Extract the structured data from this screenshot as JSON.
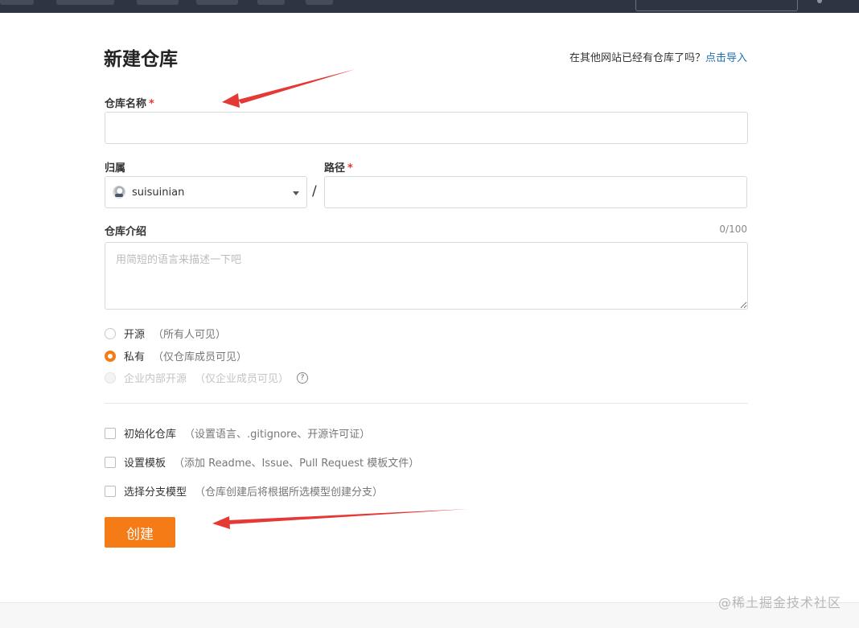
{
  "page": {
    "title": "新建仓库",
    "import_hint": "在其他网站已经有仓库了吗？",
    "import_link": "点击导入"
  },
  "form": {
    "repo_name": {
      "label": "仓库名称",
      "required_mark": "*",
      "value": ""
    },
    "owner": {
      "label": "归属",
      "value": "suisuinian"
    },
    "separator": "/",
    "path": {
      "label": "路径",
      "required_mark": "*",
      "value": ""
    },
    "description": {
      "label": "仓库介绍",
      "counter": "0/100",
      "placeholder": "用简短的语言来描述一下吧",
      "value": ""
    },
    "visibility": [
      {
        "label": "开源",
        "note": "（所有人可见）",
        "checked": false,
        "disabled": false
      },
      {
        "label": "私有",
        "note": "（仅仓库成员可见）",
        "checked": true,
        "disabled": false
      },
      {
        "label": "企业内部开源",
        "note": "（仅企业成员可见）",
        "checked": false,
        "disabled": true,
        "help_icon": "question-circle-icon"
      }
    ],
    "options": [
      {
        "label": "初始化仓库",
        "note": "（设置语言、.gitignore、开源许可证）",
        "checked": false
      },
      {
        "label": "设置模板",
        "note": "（添加 Readme、Issue、Pull Request 模板文件）",
        "checked": false
      },
      {
        "label": "选择分支模型",
        "note": "（仓库创建后将根据所选模型创建分支）",
        "checked": false
      }
    ],
    "submit_label": "创建"
  },
  "watermark": "@稀土掘金技术社区",
  "colors": {
    "accent": "#f57b17",
    "link": "#1e6fb8",
    "topbar": "#2d3543",
    "annotation_arrow": "#e53935",
    "required": "#e4393c"
  }
}
